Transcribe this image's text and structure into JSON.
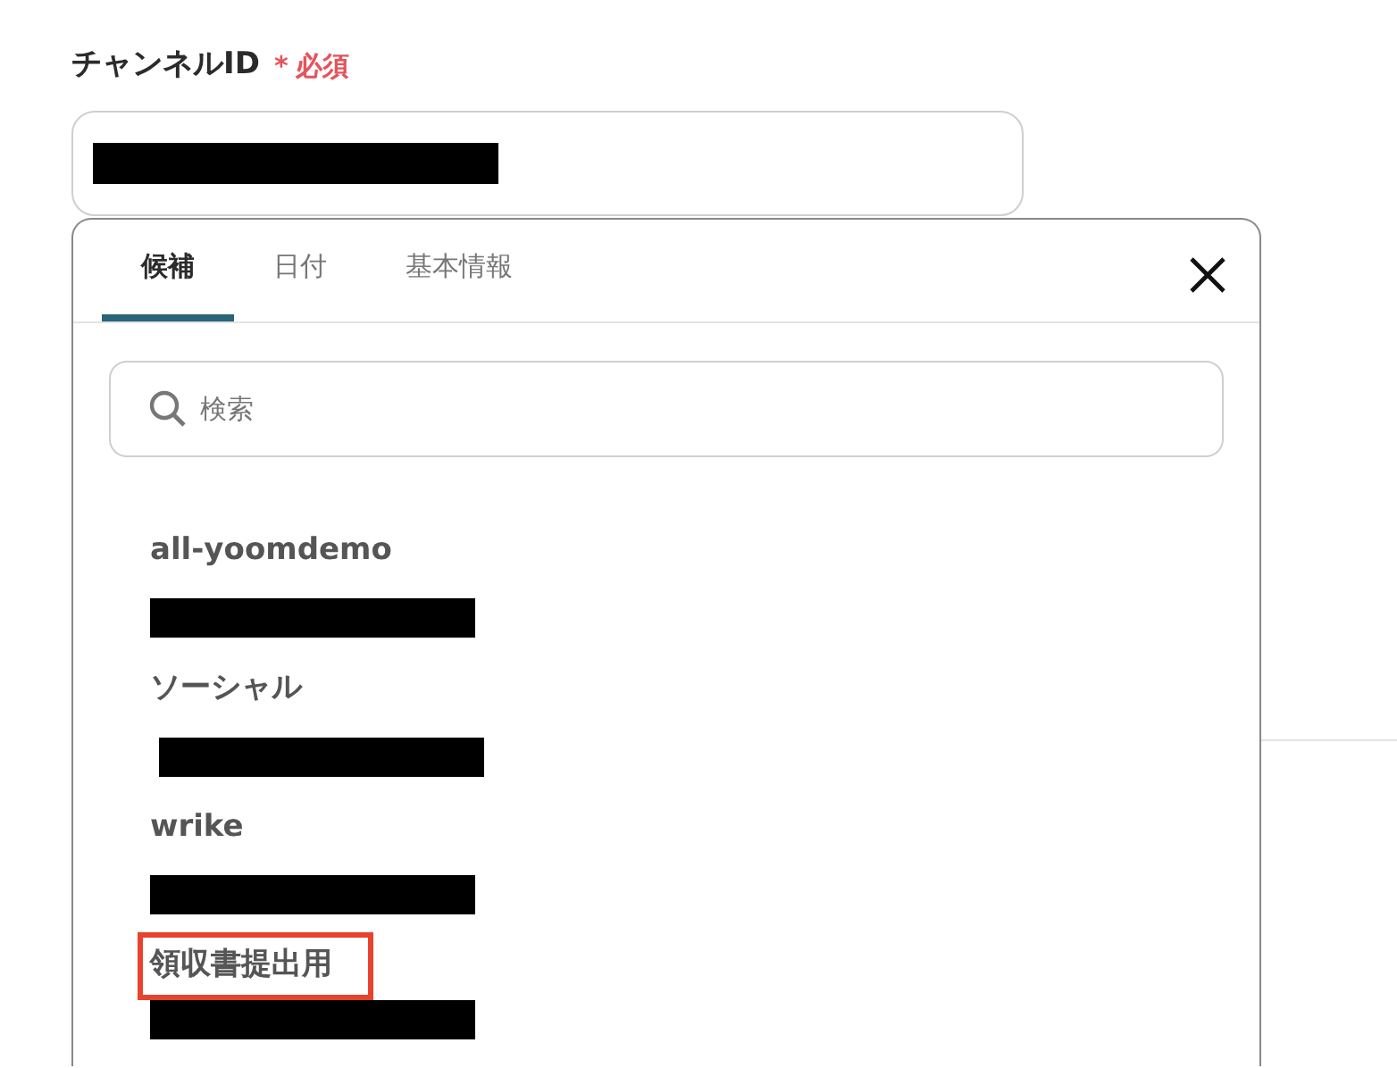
{
  "field": {
    "label": "チャンネルID",
    "required_mark": "*",
    "required_text": "必須"
  },
  "tabs": [
    {
      "label": "候補",
      "selected": true
    },
    {
      "label": "日付",
      "selected": false
    },
    {
      "label": "基本情報",
      "selected": false
    }
  ],
  "search": {
    "placeholder": "検索"
  },
  "options": [
    {
      "name": "all-yoomdemo",
      "highlighted": false
    },
    {
      "name": "ソーシャル",
      "highlighted": false
    },
    {
      "name": "wrike",
      "highlighted": false
    },
    {
      "name": "領収書提出用",
      "highlighted": true
    }
  ]
}
